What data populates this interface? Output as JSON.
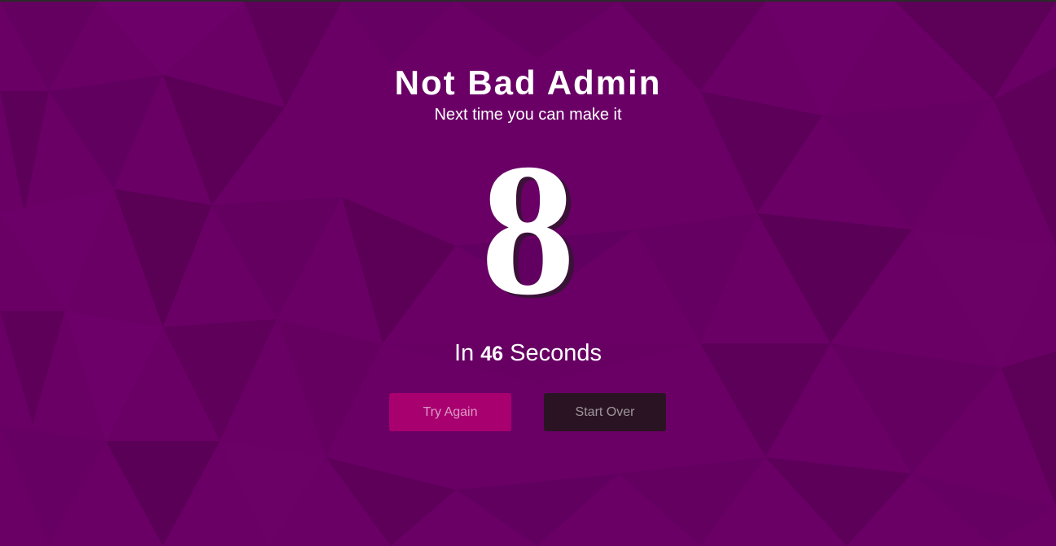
{
  "header": {
    "title": "Not Bad Admin",
    "subtitle": "Next time you can make it"
  },
  "result": {
    "score": "8",
    "time_prefix": "In",
    "time_value": "46",
    "time_suffix": "Seconds"
  },
  "buttons": {
    "try_again_label": "Try Again",
    "start_over_label": "Start Over"
  },
  "colors": {
    "background": "#6a0066",
    "try_again_button": "#a8006f",
    "start_over_button": "#2a1424"
  }
}
